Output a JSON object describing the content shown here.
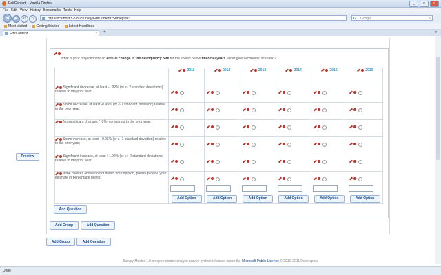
{
  "window": {
    "title": "EditContent - Mozilla Firefox",
    "buttons": [
      "_",
      "□",
      "x"
    ]
  },
  "menu": [
    "File",
    "Edit",
    "View",
    "History",
    "Bookmarks",
    "Tools",
    "Help"
  ],
  "nav": {
    "url": "http://localhost:52980/Survey/EditContent?SurveyId=3",
    "search_placeholder": "Google"
  },
  "bookmarks": [
    "Most Visited",
    "Getting Started",
    "Latest Headlines"
  ],
  "tab": {
    "label": "EditContent",
    "close": "x",
    "new_tab": "+"
  },
  "page": {
    "preview_label": "Preview",
    "question": {
      "prefix": "What is your projection for an",
      "bold1": "annual change in the delinquency rate",
      "middle": "for the shown below",
      "bold2": "financial years",
      "suffix": "under given economic scenario?"
    },
    "years": [
      "2011",
      "2012",
      "2013",
      "2014",
      "2015",
      "2016"
    ],
    "options": [
      "Significant decrease, at least -1.92% (or ≤- 2 standard deviations) relative to the prior year;",
      "Some decrease, at least -0.96% (or ≤-1 standard deviation) relative to the prior year;",
      "No significant changes (~0%) comparing to the prior year;",
      "Some increase, at least +0.96% (or ≥+1 standard deviation) relative to the prior year;",
      "Significant increase, at least +1.92% (or ≥+ 2 standard deviations) relative to the prior year;",
      "If the choices above do not match your opinion, please provide your estimate in percentage points:"
    ],
    "add_option_label": "Add Option",
    "add_question_label": "Add Question",
    "add_group_label": "Add Group"
  },
  "footer": {
    "prefix": "Survey Master 1.0 an open source analytic survey system released under the",
    "link": "Microsoft Public License",
    "suffix": "© 2010-2011 Developers"
  },
  "status": {
    "text": "Done"
  }
}
